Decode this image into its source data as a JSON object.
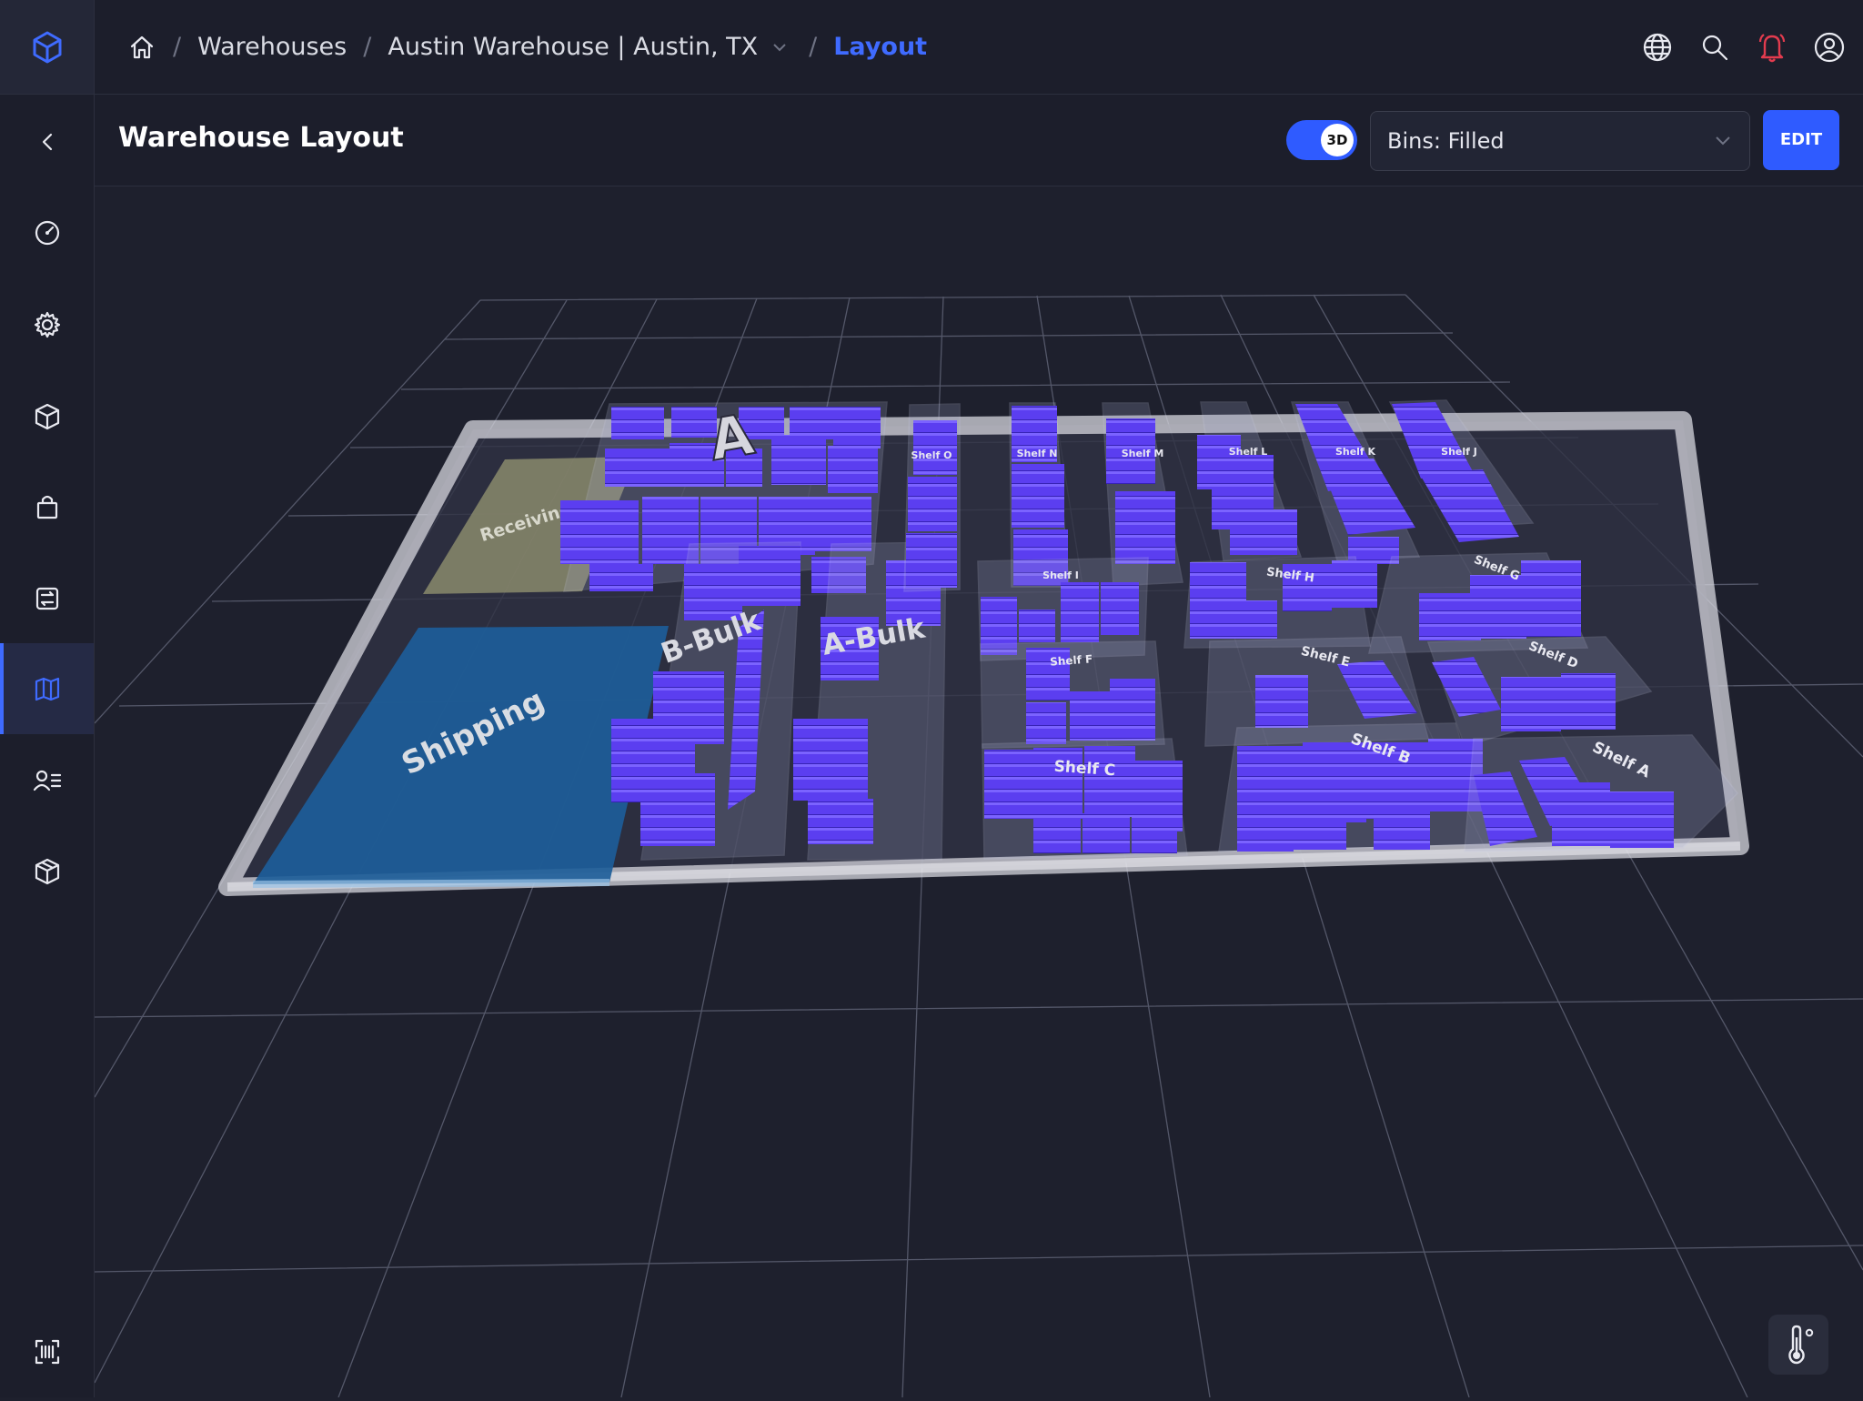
{
  "header": {
    "breadcrumbs": [
      "Warehouses",
      "Austin Warehouse | Austin, TX",
      "Layout"
    ]
  },
  "toolbar": {
    "title": "Warehouse Layout",
    "view_toggle_label": "3D",
    "view_toggle_on": true,
    "filter_select_value": "Bins: Filled",
    "edit_label": "EDIT"
  },
  "sidebar": {
    "items": [
      "collapse",
      "dashboard",
      "settings",
      "products",
      "orders",
      "transfers",
      "layout",
      "users",
      "packages",
      "scanner"
    ],
    "active": "layout"
  },
  "scene": {
    "zones": {
      "receiving": "Receiving",
      "shipping": "Shipping",
      "a_label": "A",
      "b_bulk": "B-Bulk",
      "a_bulk": "A-Bulk"
    },
    "shelves": {
      "o": "Shelf O",
      "n": "Shelf N",
      "m": "Shelf M",
      "l": "Shelf L",
      "k": "Shelf K",
      "j": "Shelf J",
      "i": "Shelf I",
      "h": "Shelf H",
      "g": "Shelf G",
      "f": "Shelf F",
      "e": "Shelf E",
      "d": "Shelf D",
      "c": "Shelf C",
      "b": "Shelf B",
      "a": "Shelf A"
    }
  },
  "colors": {
    "accent": "#3f6bff",
    "bin": "#5b3ef0",
    "alert": "#e23b4e",
    "shipping": "#1d5d99",
    "receiving": "#7e7e62"
  }
}
